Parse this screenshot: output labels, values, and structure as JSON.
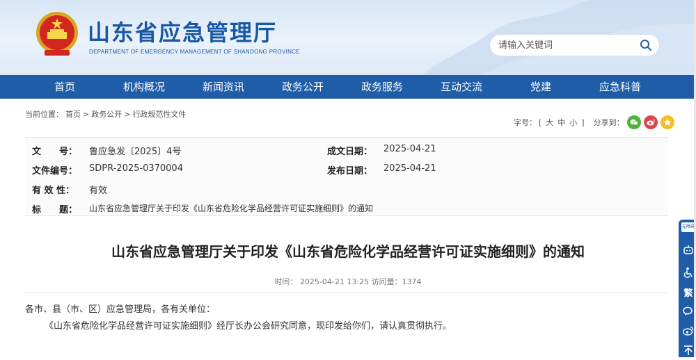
{
  "header": {
    "site_title": "山东省应急管理厅",
    "site_subtitle": "DEPARTMENT OF EMERGENCY MANAGEMENT OF SHANDONG PROVINCE",
    "search_placeholder": "请输入关键词",
    "brand_color": "#1f5da8"
  },
  "nav": {
    "items": [
      "首页",
      "机构概况",
      "新闻资讯",
      "政务公开",
      "政务服务",
      "互动交流",
      "党建",
      "应急科普"
    ]
  },
  "breadcrumb": {
    "prefix": "当前位置：",
    "items": [
      "首页",
      ">",
      "政务公开",
      ">",
      "行政规范性文件"
    ]
  },
  "tools": {
    "font_label": "字号：",
    "size_large": "大",
    "size_medium": "中",
    "size_small": "小",
    "bracket_open": "[",
    "bracket_close": "]",
    "share_label": "分享到：",
    "share_icons": [
      "wechat-icon",
      "weibo-icon",
      "qzone-icon"
    ]
  },
  "info": {
    "doc_no_label": "文　　号：",
    "doc_no": "鲁应急发〔2025〕4号",
    "created_label": "成文日期：",
    "created": "2025-04-21",
    "file_code_label": "文件编号：",
    "file_code": "SDPR-2025-0370004",
    "published_label": "发布日期：",
    "published": "2025-04-21",
    "validity_label": "有 效 性：",
    "validity": "有效",
    "title_label": "标　　题：",
    "title": "山东省应急管理厅关于印发《山东省危险化学品经营许可证实施细则》的通知"
  },
  "article": {
    "title": "山东省应急管理厅关于印发《山东省危险化学品经营许可证实施细则》的通知",
    "time_label": "时间：",
    "time": "2025-04-21 13:25",
    "views_label": "访问量：",
    "views": "1374",
    "salutation": "各市、县（市、区）应急管理局，各有关单位：",
    "body": "《山东省危险化学品经营许可证实施细则》经厅长办公会研究同意，现印发给你们，请认真贯彻执行。"
  },
  "floatbar": {
    "badge": "无障碍",
    "traditional": "繁"
  }
}
